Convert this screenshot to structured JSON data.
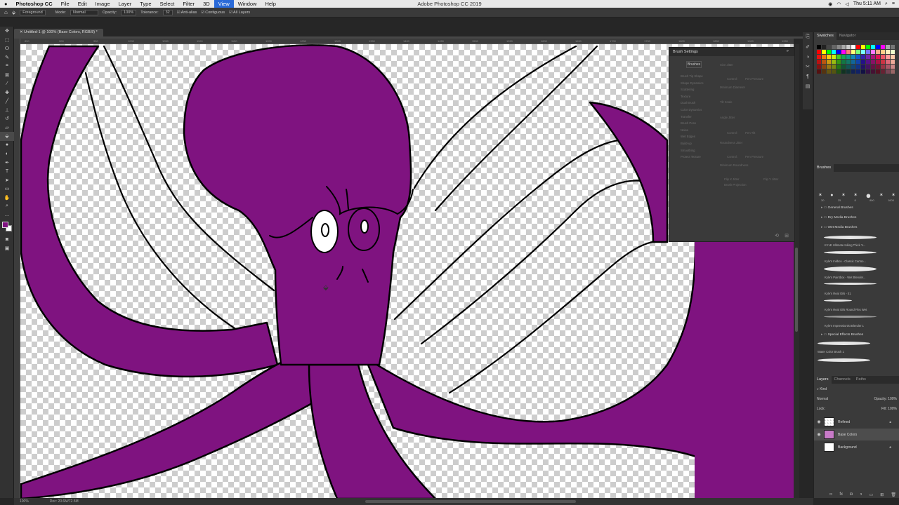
{
  "menubar": {
    "app": "Photoshop CC",
    "items": [
      "File",
      "Edit",
      "Image",
      "Layer",
      "Type",
      "Select",
      "Filter",
      "3D",
      "View",
      "Window",
      "Help"
    ],
    "active": "View",
    "window_title": "Adobe Photoshop CC 2019",
    "clock": "Thu 5:11 AM"
  },
  "options": {
    "fill_source": "Foreground",
    "mode_label": "Mode:",
    "mode_value": "Normal",
    "opacity_label": "Opacity:",
    "opacity_value": "100%",
    "tolerance_label": "Tolerance:",
    "tolerance_value": "32",
    "anti_alias": "Anti-alias",
    "contiguous": "Contiguous",
    "all_layers": "All Layers"
  },
  "document": {
    "tab": "Untitled-1 @ 100% (Base Colors, RGB/8) *",
    "ruler_ticks": [
      "850",
      "900",
      "950",
      "1000",
      "1050",
      "1100",
      "1150",
      "1200",
      "1250",
      "1300",
      "1350",
      "1400",
      "1450",
      "1500",
      "1550",
      "1600",
      "1650",
      "1700",
      "1750",
      "1800",
      "1850",
      "1900",
      "1950",
      "2000",
      "2050",
      "2100"
    ]
  },
  "status": {
    "zoom": "100%",
    "doc": "Doc: 20.6M/72.5M"
  },
  "brush_settings": {
    "title": "Brush Settings",
    "brushes_button": "Brushes",
    "options": [
      "Brush Tip Shape",
      "Shape Dynamics",
      "Scattering",
      "Texture",
      "Dual Brush",
      "Color Dynamics",
      "Transfer",
      "Brush Pose",
      "Noise",
      "Wet Edges",
      "Build-up",
      "Smoothing",
      "Protect Texture"
    ],
    "right_labels": [
      "Size Jitter",
      "Control:",
      "Pen Pressure",
      "Minimum Diameter",
      "Tilt Scale",
      "Angle Jitter",
      "Control:",
      "Pen Tilt",
      "Roundness Jitter",
      "Control:",
      "Pen Pressure",
      "Minimum Roundness",
      "Flip X Jitter",
      "Flip Y Jitter",
      "Brush Projection"
    ]
  },
  "panels": {
    "swatches_tab": "Swatches",
    "navigator_tab": "Navigator",
    "brushes_title": "Brushes",
    "brush_sizes": [
      "30",
      "25",
      "8",
      "800",
      "1600"
    ],
    "brush_folders": {
      "general": "General Brushes",
      "dry": "Dry Media Brushes",
      "wet": "Wet Media Brushes",
      "special": "Special Effects Brushes"
    },
    "brush_items": [
      "KYLE Ultimate Inking Thick 'n...",
      "Kyle's Inkbox - Classic Cartoo...",
      "Kyle's Paintbox - Wet Blender...",
      "Kyle's Real Oils - 01",
      "Kyle's Real Oils Round Flex Wet",
      "Kyle's Impressionist Blender 1",
      "Water Color Brush 1"
    ],
    "layers_tab": "Layers",
    "channels_tab": "Channels",
    "paths_tab": "Paths",
    "kind": "Kind",
    "blend_mode": "Normal",
    "opacity_label": "Opacity:",
    "opacity_value": "100%",
    "lock_label": "Lock:",
    "fill_label": "Fill:",
    "fill_value": "100%",
    "layers": [
      "Refined",
      "Base Colors",
      "Background"
    ],
    "selected_layer": "Base Colors"
  },
  "colors": {
    "octopus": "#7f1380",
    "foreground": "#7f1380",
    "background": "#ffffff",
    "menu_active": "#2a6ad8",
    "swatch_grid": [
      "#000000",
      "#222222",
      "#444444",
      "#666666",
      "#888888",
      "#aaaaaa",
      "#cccccc",
      "#ffffff",
      "#ff0000",
      "#ffff00",
      "#00ff00",
      "#00ffff",
      "#0000ff",
      "#ff00ff",
      "#aaaaaa",
      "#777777",
      "#ff0000",
      "#ffff00",
      "#00ff00",
      "#00ffff",
      "#0000ff",
      "#ff00ff",
      "#ff7777",
      "#ffff77",
      "#77ff77",
      "#77ffff",
      "#7777ff",
      "#ff77ff",
      "#ffaa88",
      "#ffcc88",
      "#ffeebb",
      "#eeffcc",
      "#ee1111",
      "#ee7711",
      "#ffcc11",
      "#ccee11",
      "#44cc22",
      "#11aa55",
      "#119988",
      "#1188bb",
      "#1155cc",
      "#3322aa",
      "#7722aa",
      "#aa1177",
      "#dd1155",
      "#ee5566",
      "#ff9999",
      "#ffccaa",
      "#bb1111",
      "#bb5511",
      "#cc9911",
      "#99bb11",
      "#339911",
      "#117744",
      "#117766",
      "#116699",
      "#1144aa",
      "#221188",
      "#551188",
      "#881166",
      "#aa1144",
      "#cc3344",
      "#dd6677",
      "#eeaa99",
      "#881111",
      "#884411",
      "#997711",
      "#778811",
      "#227711",
      "#115533",
      "#115555",
      "#114477",
      "#113388",
      "#221166",
      "#441166",
      "#661144",
      "#771133",
      "#993344",
      "#aa5566",
      "#cc8888",
      "#551111",
      "#553311",
      "#665511",
      "#555511",
      "#225511",
      "#113322",
      "#113333",
      "#112255",
      "#112266",
      "#111144",
      "#331144",
      "#441133",
      "#551122",
      "#662233",
      "#774455",
      "#996666"
    ]
  }
}
